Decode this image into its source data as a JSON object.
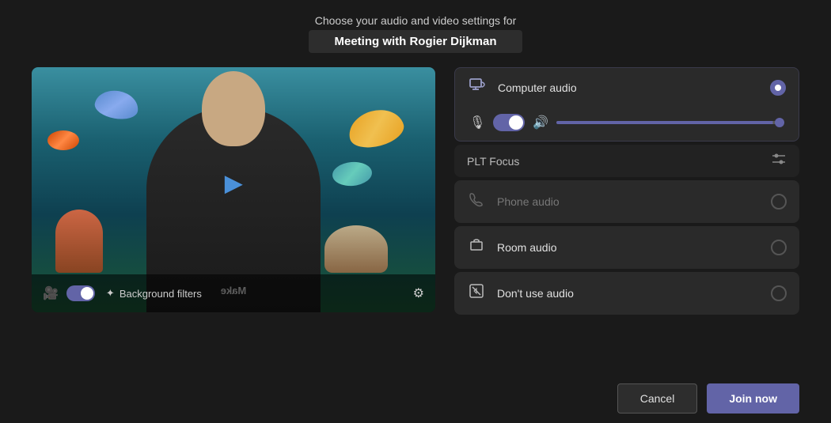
{
  "header": {
    "subtitle": "Choose your audio and video settings for",
    "title": "Meeting with Rogier Dijkman"
  },
  "video_panel": {
    "camera_on": true,
    "bg_filter_label": "Background filters"
  },
  "audio_panel": {
    "options": [
      {
        "id": "computer",
        "label": "Computer audio",
        "selected": true,
        "icon": "🖥"
      },
      {
        "id": "plt",
        "label": "PLT Focus",
        "is_device": true
      },
      {
        "id": "phone",
        "label": "Phone audio",
        "selected": false,
        "icon": "📞"
      },
      {
        "id": "room",
        "label": "Room audio",
        "selected": false,
        "icon": "🔔"
      },
      {
        "id": "none",
        "label": "Don't use audio",
        "selected": false,
        "icon": "🚫"
      }
    ]
  },
  "buttons": {
    "cancel_label": "Cancel",
    "join_label": "Join now"
  },
  "icons": {
    "camera": "🎥",
    "mic": "🎙",
    "speaker": "🔊",
    "background_filter": "✦",
    "settings": "⚙",
    "sliders": "⚙"
  }
}
